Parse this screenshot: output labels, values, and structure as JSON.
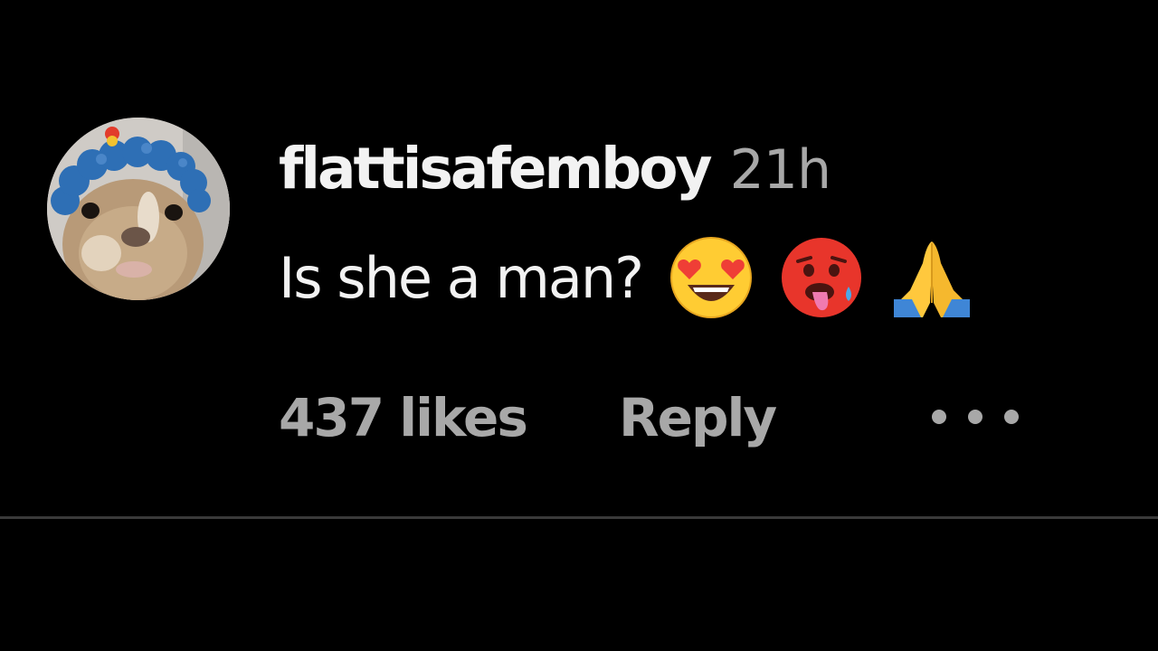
{
  "comment": {
    "username": "flattisafemboy",
    "timestamp": "21h",
    "text": "Is she a man?",
    "emojis": [
      "heart-eyes-emoji",
      "hot-face-emoji",
      "folded-hands-emoji"
    ],
    "likes_label": "437 likes",
    "reply_label": "Reply"
  },
  "colors": {
    "background": "#000000",
    "primary_text": "#f2f2f2",
    "secondary_text": "#a8a8a8",
    "divider": "#3a3a3a"
  }
}
